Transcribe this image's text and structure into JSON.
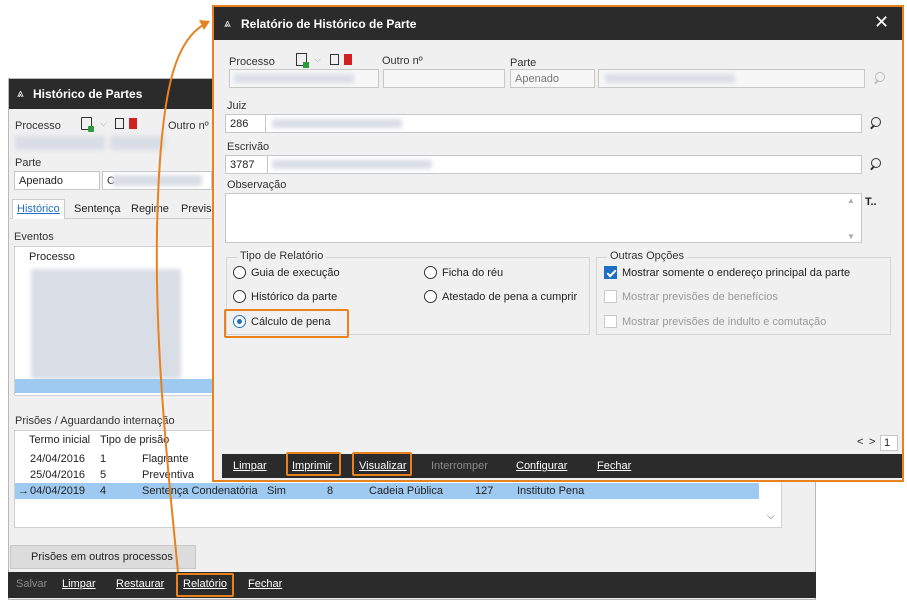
{
  "back_window": {
    "title": "Histórico de Partes",
    "labels": {
      "processo": "Processo",
      "outro_no": "Outro nº",
      "parte": "Parte",
      "eventos": "Eventos",
      "prisoes": "Prisões / Aguardando internação"
    },
    "parte_value": "Apenado",
    "parte_name_initial": "C",
    "tabs": [
      "Histórico",
      "Sentença",
      "Regime",
      "Previs"
    ],
    "events_header": "Processo",
    "prisoes_headers": [
      "Termo inicial",
      "Tipo de prisão"
    ],
    "prisoes_rows": [
      {
        "arrow": "",
        "date": "24/04/2016",
        "num": "1",
        "tipo": "Flagrante"
      },
      {
        "arrow": "",
        "date": "25/04/2016",
        "num": "5",
        "tipo": "Preventiva"
      },
      {
        "arrow": "→",
        "date": "04/04/2019",
        "num": "4",
        "tipo": "Sentença Condenatória",
        "sim": "Sim",
        "n8": "8",
        "local": "Cadeia Pública",
        "n127": "127",
        "inst": "Instituto Pena"
      }
    ],
    "bottom_tab": "Prisões em outros processos",
    "toolbar": {
      "salvar": "Salvar",
      "limpar": "Limpar",
      "restaurar": "Restaurar",
      "relatorio": "Relatório",
      "fechar": "Fechar"
    }
  },
  "dialog": {
    "title": "Relatório de Histórico de Parte",
    "labels": {
      "processo": "Processo",
      "outro_no": "Outro nº",
      "parte": "Parte",
      "juiz": "Juiz",
      "escrivao": "Escrivão",
      "observacao": "Observação"
    },
    "parte_value": "Apenado",
    "juiz_code": "286",
    "escrivao_code": "3787",
    "tipo_relatorio": {
      "title": "Tipo de Relatório",
      "options": [
        "Guia de execução",
        "Histórico da parte",
        "Cálculo de pena",
        "Ficha do réu",
        "Atestado de pena a cumprir"
      ],
      "selected": "Cálculo de pena"
    },
    "outras_opcoes": {
      "title": "Outras Opções",
      "options": [
        {
          "label": "Mostrar somente o endereço principal da parte",
          "checked": true,
          "enabled": true
        },
        {
          "label": "Mostrar previsões de benefícios",
          "checked": false,
          "enabled": false
        },
        {
          "label": "Mostrar previsões de indulto e comutação",
          "checked": false,
          "enabled": false
        }
      ]
    },
    "pager": {
      "prev": "<",
      "next": ">",
      "page": "1"
    },
    "toolbar": {
      "limpar": "Limpar",
      "imprimir": "Imprimir",
      "visualizar": "Visualizar",
      "interromper": "Interromper",
      "configurar": "Configurar",
      "fechar": "Fechar"
    }
  },
  "colors": {
    "highlight": "#e8821e",
    "titlebar": "#2b2b2b",
    "selection": "#9ec9f0",
    "accent": "#1d6fc4"
  }
}
